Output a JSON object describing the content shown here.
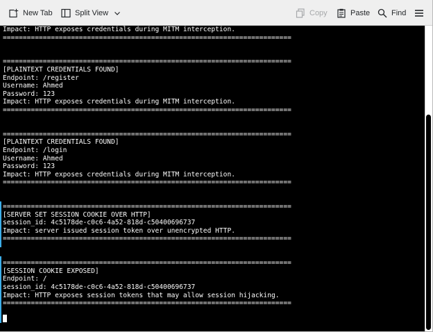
{
  "toolbar": {
    "new_tab_label": "New Tab",
    "split_view_label": "Split View",
    "copy_label": "Copy",
    "paste_label": "Paste",
    "find_label": "Find"
  },
  "icons": {
    "new_tab": "new-tab-icon",
    "split_view": "split-view-icon",
    "dropdown": "chevron-down-icon",
    "copy": "copy-icon",
    "paste": "paste-icon",
    "find": "search-icon",
    "menu": "hamburger-menu-icon"
  },
  "colors": {
    "terminal_bg": "#000000",
    "terminal_fg": "#fcfcfc",
    "marker": "#3daee9"
  },
  "terminal": {
    "lines": [
      "Impact: HTTP exposes credentials during MITM interception.",
      "========================================================================",
      "",
      "",
      "========================================================================",
      "[PLAINTEXT CREDENTIALS FOUND]",
      "Endpoint: /register",
      "Username: Ahmed",
      "Password: 123",
      "Impact: HTTP exposes credentials during MITM interception.",
      "========================================================================",
      "",
      "",
      "========================================================================",
      "[PLAINTEXT CREDENTIALS FOUND]",
      "Endpoint: /login",
      "Username: Ahmed",
      "Password: 123",
      "Impact: HTTP exposes credentials during MITM interception.",
      "========================================================================",
      "",
      "",
      "========================================================================",
      "[SERVER SET SESSION COOKIE OVER HTTP]",
      "session_id: 4c5178de-c0c6-4a52-818d-c50400696737",
      "Impact: server issued session token over unencrypted HTTP.",
      "========================================================================",
      "",
      "",
      "========================================================================",
      "[SESSION COOKIE EXPOSED]",
      "Endpoint: /",
      "session_id: 4c5178de-c0c6-4a52-818d-c50400696737",
      "Impact: HTTP exposes session tokens that may allow session hijacking.",
      "========================================================================"
    ]
  }
}
